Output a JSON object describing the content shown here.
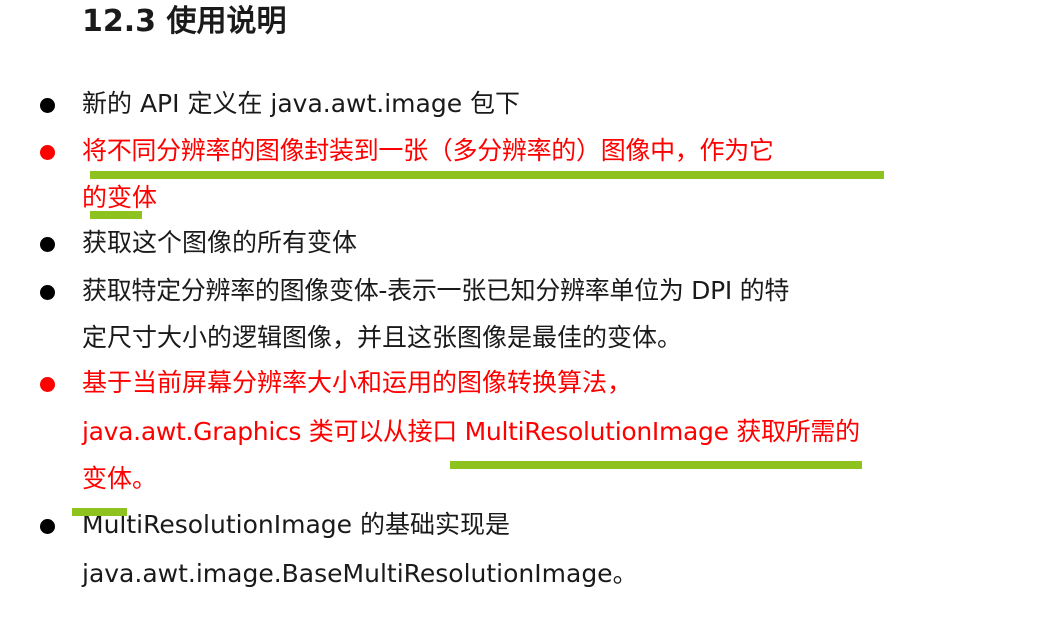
{
  "heading": "12.3  使用说明",
  "colors": {
    "text": "#1a1a1a",
    "highlight_text": "#ff0000",
    "underline": "#8dc21f"
  },
  "bullets": [
    {
      "highlight": false,
      "lines": [
        "新的 API 定义在 java.awt.image 包下"
      ]
    },
    {
      "highlight": true,
      "lines": [
        "将不同分辨率的图像封装到一张（多分辨率的）图像中，作为它",
        "的变体"
      ]
    },
    {
      "highlight": false,
      "lines": [
        "获取这个图像的所有变体"
      ]
    },
    {
      "highlight": false,
      "lines": [
        "获取特定分辨率的图像变体-表示一张已知分辨率单位为 DPI 的特",
        "定尺寸大小的逻辑图像，并且这张图像是最佳的变体。"
      ]
    },
    {
      "highlight": true,
      "lines": [
        "基于当前屏幕分辨率大小和运用的图像转换算法，",
        "java.awt.Graphics 类可以从接口 MultiResolutionImage 获取所需的",
        "变体。"
      ]
    },
    {
      "highlight": false,
      "lines": [
        "MultiResolutionImage 的基础实现是",
        "java.awt.image.BaseMultiResolutionImage。"
      ]
    }
  ]
}
